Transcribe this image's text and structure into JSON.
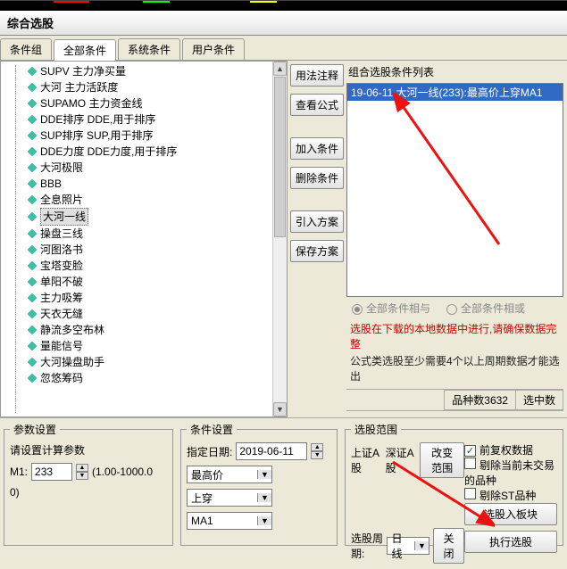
{
  "title": "综合选股",
  "tabs": [
    "条件组",
    "全部条件",
    "系统条件",
    "用户条件"
  ],
  "active_tab_index": 1,
  "tree_items": [
    {
      "label": "SUPV 主力净买量"
    },
    {
      "label": "大河 主力活跃度"
    },
    {
      "label": "SUPAMO 主力资金线"
    },
    {
      "label": "DDE排序 DDE,用于排序"
    },
    {
      "label": "SUP排序 SUP,用于排序"
    },
    {
      "label": "DDE力度 DDE力度,用于排序"
    },
    {
      "label": "大河极限"
    },
    {
      "label": "BBB"
    },
    {
      "label": "全息照片"
    },
    {
      "label": "大河一线",
      "selected": true
    },
    {
      "label": "操盘三线"
    },
    {
      "label": "河图洛书"
    },
    {
      "label": "宝塔变脸"
    },
    {
      "label": "单阳不破"
    },
    {
      "label": "主力吸筹"
    },
    {
      "label": "天衣无缝"
    },
    {
      "label": "静流多空布林"
    },
    {
      "label": "量能信号"
    },
    {
      "label": "大河操盘助手"
    },
    {
      "label": "忽悠筹码"
    }
  ],
  "mid_buttons": {
    "usage": "用法注释",
    "view_formula": "查看公式",
    "add_cond": "加入条件",
    "del_cond": "删除条件",
    "import_plan": "引入方案",
    "save_plan": "保存方案"
  },
  "right": {
    "heading": "组合选股条件列表",
    "list_row": "19-06-11  大河一线(233):最高价上穿MA1",
    "radio_all_and": "全部条件相与",
    "radio_all_or": "全部条件相或",
    "warning": "选股在下载的本地数据中进行,请确保数据完整",
    "note": "公式类选股至少需要4个以上周期数据才能选出",
    "status_count": "品种数3632",
    "status_selected": "选中数"
  },
  "param": {
    "legend": "参数设置",
    "hint": "请设置计算参数",
    "m1_label": "M1:",
    "m1_value": "233",
    "m1_range": "(1.00-1000.0",
    "m1_range2": "0)"
  },
  "cond": {
    "legend": "条件设置",
    "date_label": "指定日期:",
    "date_value": "2019-06-11",
    "sel1": "最高价",
    "sel2": "上穿",
    "sel3": "MA1"
  },
  "scope": {
    "legend": "选股范围",
    "sh": "上证A 股",
    "sz": "深证A 股",
    "change_scope": "改变范围",
    "cycle_label": "选股周期:",
    "cycle_value": "日线",
    "detail": "关闭",
    "chk_qfq": "前复权数据",
    "chk_excl_notrade": "剔除当前未交易的品种",
    "chk_excl_st": "剔除ST品种",
    "btn_to_block": "选股入板块",
    "btn_execute": "执行选股"
  }
}
